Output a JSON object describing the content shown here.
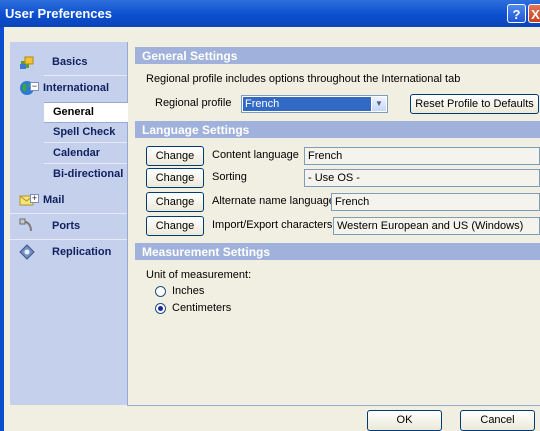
{
  "window": {
    "title": "User Preferences",
    "help_label": "?",
    "close_label": "X"
  },
  "sidebar": {
    "basics": "Basics",
    "international": "International",
    "international_sub": [
      "General",
      "Spell Check",
      "Calendar",
      "Bi-directional"
    ],
    "mail": "Mail",
    "ports": "Ports",
    "replication": "Replication"
  },
  "general": {
    "header": "General Settings",
    "description": "Regional profile includes options throughout the International tab",
    "profile_label": "Regional profile",
    "profile_value": "French",
    "reset_label": "Reset Profile to Defaults"
  },
  "language": {
    "header": "Language Settings",
    "change_label": "Change",
    "rows": [
      {
        "label": "Content language",
        "value": "French"
      },
      {
        "label": "Sorting",
        "value": "- Use OS -"
      },
      {
        "label": "Alternate name language",
        "value": "French"
      },
      {
        "label": "Import/Export characters",
        "value": "Western European and US (Windows)"
      }
    ]
  },
  "measurement": {
    "header": "Measurement Settings",
    "unit_label": "Unit of measurement:",
    "options": [
      "Inches",
      "Centimeters"
    ],
    "selected": "Centimeters"
  },
  "footer": {
    "ok_label": "OK",
    "cancel_label": "Cancel"
  }
}
